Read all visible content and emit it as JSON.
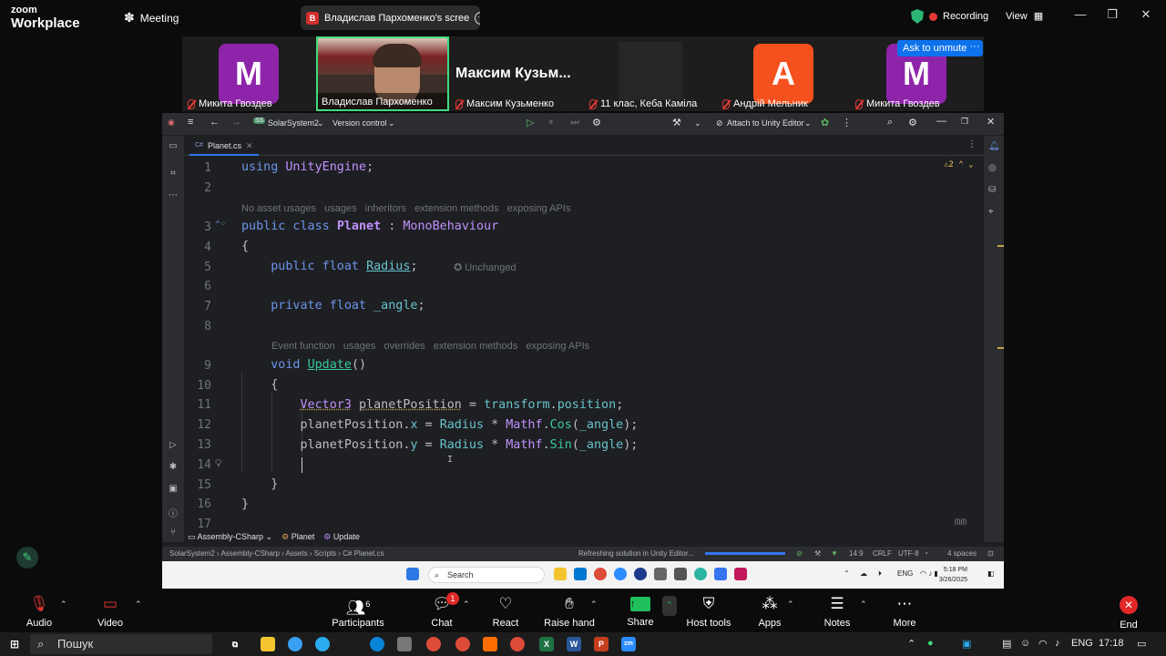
{
  "zoom": {
    "logo_line1": "zoom",
    "logo_line2": "Workplace",
    "meeting_label": "Meeting",
    "share_title": "Владислав Пархоменко's scree",
    "share_badge": "В",
    "recording_label": "Recording",
    "view_label": "View",
    "ask_unmute": "Ask to unmute"
  },
  "participants": [
    {
      "name": "Микита Гвоздев",
      "initial": "M",
      "color": "#8e24aa"
    },
    {
      "name": "Владислав Пархоменко",
      "video": true
    },
    {
      "name": "Максим Кузьменко",
      "display": "Максим  Кузьм..."
    },
    {
      "name": "11 клас, Кеба Каміла",
      "video": true
    },
    {
      "name": "Андрій Мельник",
      "initial": "A",
      "color": "#f4511e"
    },
    {
      "name": "Микита Гвоздев",
      "initial": "M",
      "color": "#8e24aa"
    }
  ],
  "ide": {
    "project": "SolarSystem2",
    "project_badge": "SS",
    "version_control": "Version control",
    "attach": "Attach to Unity Editor",
    "tab": "Planet.cs",
    "tab_lang": "C#",
    "warnings": "2",
    "lines": [
      "1",
      "2",
      "3",
      "4",
      "5",
      "6",
      "7",
      "8",
      "9",
      "10",
      "11",
      "12",
      "13",
      "14",
      "15",
      "16",
      "17"
    ],
    "hint1": "No asset usages   usages   inheritors   extension methods   exposing APIs",
    "hint2": "Event function   usages   overrides   extension methods   exposing APIs",
    "unchanged": "Unchanged",
    "breadcrumb": [
      "Assembly-CSharp",
      "Planet",
      "Update"
    ],
    "status_path": "SolarSystem2 › Assembly-CSharp › Assets › Scripts › C# Planet.cs",
    "status_msg": "Refreshing solution in Unity Editor...",
    "status_pos": "14:9",
    "status_crlf": "CRLF",
    "status_enc": "UTF-8",
    "status_indent": "4 spaces",
    "refresh_progress": 1.0
  },
  "desktop": {
    "search": "Search",
    "lang": "ENG",
    "time": "5:18 PM",
    "date": "3/26/2025"
  },
  "toolbar": {
    "audio": "Audio",
    "video": "Video",
    "participants": "Participants",
    "participants_count": "6",
    "chat": "Chat",
    "chat_badge": "1",
    "react": "React",
    "raise_hand": "Raise hand",
    "share": "Share",
    "host_tools": "Host tools",
    "apps": "Apps",
    "notes": "Notes",
    "more": "More",
    "end": "End"
  },
  "windows": {
    "search": "Пошук",
    "lang": "ENG",
    "time": "17:18"
  }
}
